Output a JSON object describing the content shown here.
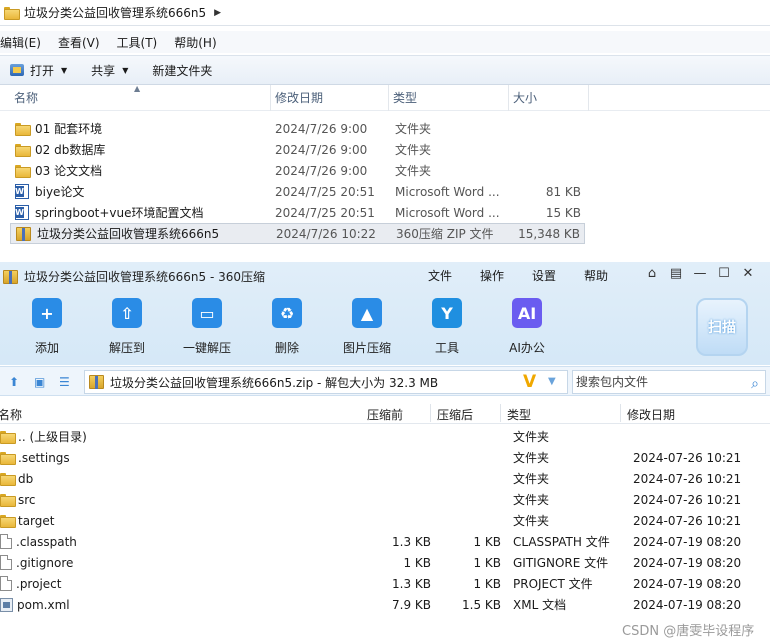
{
  "explorer": {
    "breadcrumb": "垃圾分类公益回收管理系统666n5",
    "menu": [
      "编辑(E)",
      "查看(V)",
      "工具(T)",
      "帮助(H)"
    ],
    "toolbar": {
      "open": "打开",
      "share": "共享",
      "new_folder": "新建文件夹"
    },
    "columns": {
      "name": "名称",
      "date": "修改日期",
      "type": "类型",
      "size": "大小"
    },
    "rows": [
      {
        "name": "01 配套环境",
        "date": "2024/7/26 9:00",
        "type": "文件夹",
        "size": "",
        "icon": "folder-icon"
      },
      {
        "name": "02 db数据库",
        "date": "2024/7/26 9:00",
        "type": "文件夹",
        "size": "",
        "icon": "folder-icon"
      },
      {
        "name": "03 论文文档",
        "date": "2024/7/26 9:00",
        "type": "文件夹",
        "size": "",
        "icon": "folder-icon"
      },
      {
        "name": "biye论文",
        "date": "2024/7/25 20:51",
        "type": "Microsoft Word ...",
        "size": "81 KB",
        "icon": "word-icon"
      },
      {
        "name": "springboot+vue环境配置文档",
        "date": "2024/7/25 20:51",
        "type": "Microsoft Word ...",
        "size": "15 KB",
        "icon": "word-icon"
      },
      {
        "name": "垃圾分类公益回收管理系统666n5",
        "date": "2024/7/26 10:22",
        "type": "360压缩 ZIP 文件",
        "size": "15,348 KB",
        "icon": "zip-icon",
        "selected": true
      }
    ]
  },
  "zip": {
    "title": "垃圾分类公益回收管理系统666n5 - 360压缩",
    "menu": [
      "文件",
      "操作",
      "设置",
      "帮助"
    ],
    "tools": [
      {
        "label": "添加",
        "icon": "add-icon",
        "color": "#2a8ce6",
        "glyph": "+"
      },
      {
        "label": "解压到",
        "icon": "extract-to-icon",
        "color": "#2a8ce6",
        "glyph": "⇧"
      },
      {
        "label": "一键解压",
        "icon": "one-click-extract-icon",
        "color": "#2a8ce6",
        "glyph": "▭"
      },
      {
        "label": "删除",
        "icon": "delete-icon",
        "color": "#2a8ce6",
        "glyph": "♻"
      },
      {
        "label": "图片压缩",
        "icon": "image-compress-icon",
        "color": "#2a8ce6",
        "glyph": "▲"
      },
      {
        "label": "工具",
        "icon": "tools-icon",
        "color": "#1f8fe0",
        "glyph": "Y"
      },
      {
        "label": "AI办公",
        "icon": "ai-office-icon",
        "color": "#6a5cf0",
        "glyph": "AI"
      }
    ],
    "scan": "扫描",
    "path": "垃圾分类公益回收管理系统666n5.zip - 解包大小为 32.3 MB",
    "search_placeholder": "搜索包内文件",
    "columns": {
      "name": "名称",
      "before": "压缩前",
      "after": "压缩后",
      "type": "类型",
      "date": "修改日期"
    },
    "rows": [
      {
        "name": ".. (上级目录)",
        "before": "",
        "after": "",
        "type": "文件夹",
        "date": "",
        "icon": "folder-icon"
      },
      {
        "name": ".settings",
        "before": "",
        "after": "",
        "type": "文件夹",
        "date": "2024-07-26 10:21",
        "icon": "folder-icon"
      },
      {
        "name": "db",
        "before": "",
        "after": "",
        "type": "文件夹",
        "date": "2024-07-26 10:21",
        "icon": "folder-icon"
      },
      {
        "name": "src",
        "before": "",
        "after": "",
        "type": "文件夹",
        "date": "2024-07-26 10:21",
        "icon": "folder-icon"
      },
      {
        "name": "target",
        "before": "",
        "after": "",
        "type": "文件夹",
        "date": "2024-07-26 10:21",
        "icon": "folder-icon"
      },
      {
        "name": ".classpath",
        "before": "1.3 KB",
        "after": "1 KB",
        "type": "CLASSPATH 文件",
        "date": "2024-07-19 08:20",
        "icon": "file-icon"
      },
      {
        "name": ".gitignore",
        "before": "1 KB",
        "after": "1 KB",
        "type": "GITIGNORE 文件",
        "date": "2024-07-19 08:20",
        "icon": "file-icon"
      },
      {
        "name": ".project",
        "before": "1.3 KB",
        "after": "1 KB",
        "type": "PROJECT 文件",
        "date": "2024-07-19 08:20",
        "icon": "file-icon"
      },
      {
        "name": "pom.xml",
        "before": "7.9 KB",
        "after": "1.5 KB",
        "type": "XML 文档",
        "date": "2024-07-19 08:20",
        "icon": "xml-icon"
      }
    ]
  },
  "watermark": "CSDN @唐雯毕设程序"
}
